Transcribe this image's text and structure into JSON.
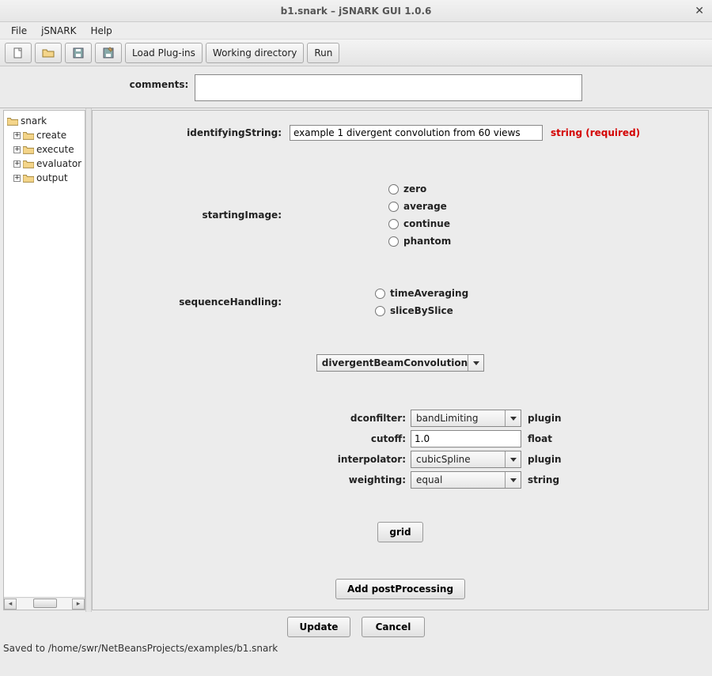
{
  "window": {
    "title": "b1.snark – jSNARK GUI 1.0.6"
  },
  "menu": {
    "file": "File",
    "jsnark": "jSNARK",
    "help": "Help"
  },
  "toolbar": {
    "loadPlugins": "Load Plug-ins",
    "workingDir": "Working directory",
    "run": "Run"
  },
  "comments": {
    "label": "comments:",
    "value": ""
  },
  "tree": {
    "root": "snark",
    "items": [
      "create",
      "execute",
      "evaluator",
      "output"
    ]
  },
  "form": {
    "identifyingString": {
      "label": "identifyingString:",
      "value": "example 1 divergent convolution from 60 views",
      "req": "string (required)"
    },
    "startingImage": {
      "label": "startingImage:",
      "options": [
        "zero",
        "average",
        "continue",
        "phantom"
      ]
    },
    "sequenceHandling": {
      "label": "sequenceHandling:",
      "options": [
        "timeAveraging",
        "sliceBySlice"
      ]
    },
    "algorithm": {
      "value": "divergentBeamConvolution"
    },
    "params": {
      "dconfilter": {
        "label": "dconfilter:",
        "value": "bandLimiting",
        "type": "plugin"
      },
      "cutoff": {
        "label": "cutoff:",
        "value": "1.0",
        "type": "float"
      },
      "interpolator": {
        "label": "interpolator:",
        "value": "cubicSpline",
        "type": "plugin"
      },
      "weighting": {
        "label": "weighting:",
        "value": "equal",
        "type": "string"
      }
    },
    "gridBtn": "grid",
    "addPostBtn": "Add postProcessing"
  },
  "footer": {
    "update": "Update",
    "cancel": "Cancel"
  },
  "status": "Saved to /home/swr/NetBeansProjects/examples/b1.snark"
}
